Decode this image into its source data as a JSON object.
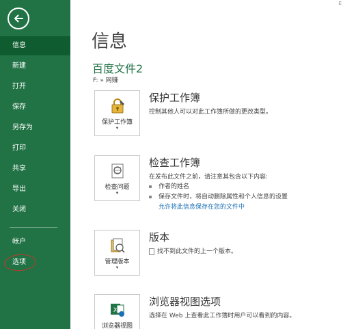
{
  "sidebar": {
    "items": [
      {
        "label": "信息"
      },
      {
        "label": "新建"
      },
      {
        "label": "打开"
      },
      {
        "label": "保存"
      },
      {
        "label": "另存为"
      },
      {
        "label": "打印"
      },
      {
        "label": "共享"
      },
      {
        "label": "导出"
      },
      {
        "label": "关闭"
      },
      {
        "label": "帐户"
      },
      {
        "label": "选项"
      }
    ],
    "active_item": "信息",
    "highlighted_item": "选项"
  },
  "main": {
    "title": "信息",
    "file_name": "百度文件2",
    "file_path": "F: » 网赚",
    "corner_glyph": "E",
    "sections": [
      {
        "tile_label": "保护工作簿",
        "title": "保护工作簿",
        "description": "控制其他人可以对此工作簿所做的更改类型。"
      },
      {
        "tile_label": "检查问题",
        "title": "检查工作簿",
        "description": "在发布此文件之前，请注意其包含以下内容:",
        "bullets": [
          "作者的姓名",
          "保存文件时，将自动删除属性和个人信息的设置"
        ],
        "link": "允许将此信息保存在您的文件中"
      },
      {
        "tile_label": "管理版本",
        "title": "版本",
        "description": "找不到此文件的上一个版本。"
      },
      {
        "tile_label": "浏览器视图",
        "title": "浏览器视图选项",
        "description": "选择在 Web 上查看此工作簿时用户可以看到的内容。"
      }
    ]
  },
  "colors": {
    "sidebar_bg": "#217346",
    "sidebar_active": "#0e5c2f",
    "accent_green": "#217346",
    "link_blue": "#1a6fb5",
    "annotation_red": "#c0392b"
  },
  "icons": [
    "back-arrow-icon",
    "lock-key-icon",
    "inspect-document-icon",
    "version-history-icon",
    "excel-browser-icon"
  ]
}
